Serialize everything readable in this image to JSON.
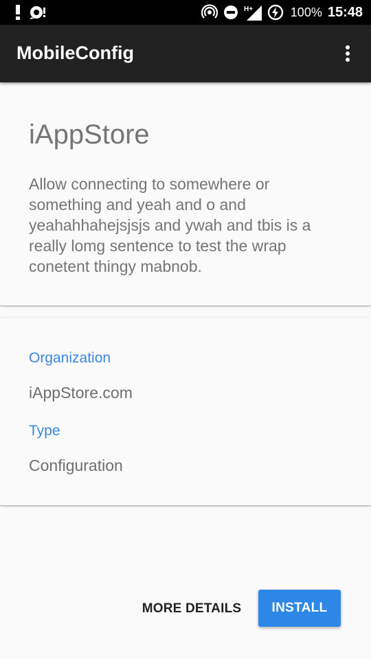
{
  "status_bar": {
    "icons": [
      "alert-icon",
      "notification-icon",
      "hotspot-icon",
      "do-not-disturb-icon",
      "signal-icon",
      "battery-charging-icon"
    ],
    "network_label": "H+",
    "battery": "100%",
    "time": "15:48"
  },
  "toolbar": {
    "title": "MobileConfig",
    "overflow_icon": "more-vert-icon"
  },
  "profile_card": {
    "title": "iAppStore",
    "description": "Allow connecting to somewhere or something and yeah and  o and yeahahhahejsjsjs and ywah and tbis is a really lomg sentence to test the wrap conetent thingy mabnob."
  },
  "info_card": {
    "organization_label": "Organization",
    "organization_value": "iAppStore.com",
    "type_label": "Type",
    "type_value": "Configuration"
  },
  "actions": {
    "more_details_label": "MORE DETAILS",
    "install_label": "INSTALL"
  },
  "colors": {
    "accent": "#3b86e0",
    "install_button": "#2c87e6",
    "toolbar": "#212121",
    "status_bar": "#000000",
    "background": "#fafafa"
  }
}
